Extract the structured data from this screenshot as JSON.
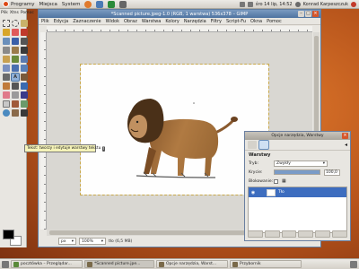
{
  "top_panel": {
    "menus": [
      "Programy",
      "Miejsca",
      "System"
    ],
    "clock": "śro 14 lip, 14:52",
    "user": "Konrad Karpeszczuk"
  },
  "toolbox": {
    "menus": [
      "Plik",
      "Xtns",
      "Pomoc"
    ]
  },
  "image_window": {
    "title": "*Scanned picture.jpeg-1.0 (RGB, 1 warstwa) 536x378 – GIMP",
    "menus": [
      "Plik",
      "Edycja",
      "Zaznaczenie",
      "Widok",
      "Obraz",
      "Warstwa",
      "Kolory",
      "Narzędzia",
      "Filtry",
      "Script-Fu",
      "Okna",
      "Pomoc"
    ],
    "status": {
      "unit": "px",
      "zoom": "100%",
      "info": "tło (6,5 MB)"
    }
  },
  "tooltip": {
    "text": "Tekst: tworzy i edytuje warstwy tekstu",
    "badge": "T"
  },
  "dialog": {
    "title": "Opcje narzędzia, Warstwy",
    "section": "Warstwy",
    "mode_label": "Tryb:",
    "mode_value": "Zwykły",
    "opacity_label": "Krycie:",
    "opacity_value": "100,0",
    "opacity_fraction": 1.0,
    "lock_label": "Blokowanie:",
    "layer_name": "Tło"
  },
  "taskbar": {
    "tasks": [
      "pocztówka – Przeglądar...",
      "*Scanned picture.jpe...",
      "Opcje narzędzia, Warst...",
      "Przybornik"
    ]
  },
  "colors": {
    "accent": "#3d6dbf",
    "desktop": "#c7621f"
  }
}
